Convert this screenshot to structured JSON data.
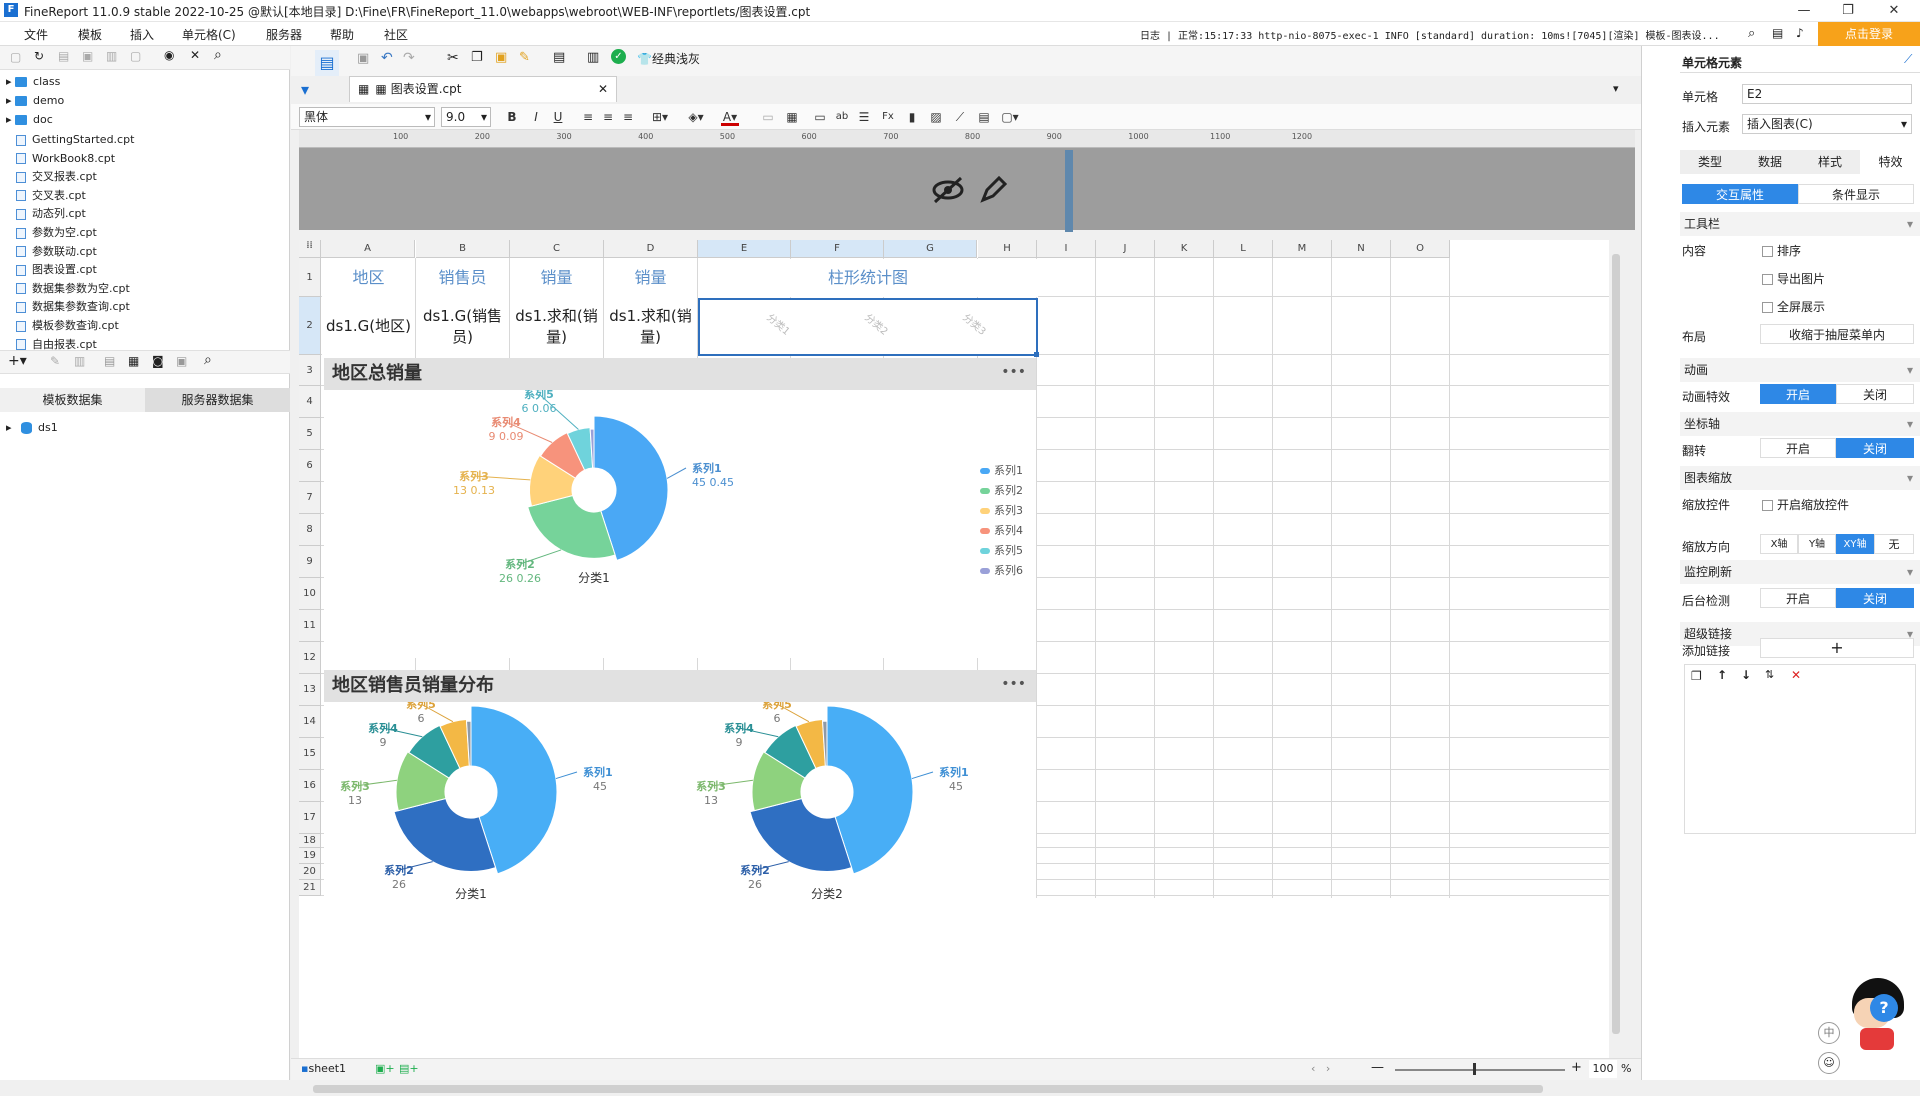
{
  "window": {
    "title": "FineReport 11.0.9 stable 2022-10-25 @默认[本地目录]   D:\\Fine\\FR\\FineReport_11.0\\webapps\\webroot\\WEB-INF\\reportlets/图表设置.cpt",
    "minimize": "—",
    "restore": "❐",
    "close": "✕"
  },
  "menu": {
    "items": [
      "文件",
      "模板",
      "插入",
      "单元格(C)",
      "服务器",
      "帮助",
      "社区"
    ],
    "log": "日志  | 正常:15:17:33 http-nio-8075-exec-1 INFO [standard] duration: 10ms![7045][渲染] 模板-图表设...",
    "login": "点击登录"
  },
  "left": {
    "tree": [
      "class",
      "demo",
      "doc"
    ],
    "files": [
      "GettingStarted.cpt",
      "WorkBook8.cpt",
      "交叉报表.cpt",
      "交叉表.cpt",
      "动态列.cpt",
      "参数为空.cpt",
      "参数联动.cpt",
      "图表设置.cpt",
      "数据集参数为空.cpt",
      "数据集参数查询.cpt",
      "模板参数查询.cpt",
      "自由报表.cpt"
    ],
    "tab_template": "模板数据集",
    "tab_server": "服务器数据集",
    "dataset": "ds1"
  },
  "editor": {
    "doc_tab": "图表设置.cpt",
    "font": "黑体",
    "font_size": "9.0",
    "classic_btn": "经典浅灰",
    "ruler_ticks": [
      "100",
      "200",
      "300",
      "400",
      "500",
      "600",
      "700",
      "800",
      "900",
      "1000",
      "1100",
      "1200"
    ],
    "columns": [
      "A",
      "B",
      "C",
      "D",
      "E",
      "F",
      "G",
      "H",
      "I",
      "J",
      "K",
      "L",
      "M",
      "N",
      "O"
    ],
    "rows": [
      "1",
      "2",
      "3",
      "4",
      "5",
      "6",
      "7",
      "8",
      "9",
      "10",
      "11",
      "12",
      "13",
      "14",
      "15",
      "16",
      "17",
      "18",
      "19",
      "20",
      "21"
    ],
    "headers": [
      "地区",
      "销售员",
      "销量",
      "销量",
      "柱形统计图"
    ],
    "data_row": [
      "ds1.G(地区)",
      "ds1.G(销售员)",
      "ds1.求和(销量)",
      "ds1.求和(销量)"
    ],
    "mini_cats": [
      "分类1",
      "分类2",
      "分类3"
    ],
    "sheet": "sheet1",
    "zoom": "100"
  },
  "chart1": {
    "title": "地区总销量",
    "legend": [
      "系列1",
      "系列2",
      "系列3",
      "系列4",
      "系列5",
      "系列6"
    ],
    "category": "分类1",
    "labels": [
      {
        "name": "系列1",
        "val": "45  0.45"
      },
      {
        "name": "系列2",
        "val": "26  0.26"
      },
      {
        "name": "系列3",
        "val": "13  0.13"
      },
      {
        "name": "系列4",
        "val": "9  0.09"
      },
      {
        "name": "系列5",
        "val": "6  0.06"
      }
    ]
  },
  "chart2": {
    "title": "地区销售员销量分布",
    "cat_left": "分类1",
    "cat_right": "分类2",
    "labels": [
      {
        "name": "系列1",
        "val": "45"
      },
      {
        "name": "系列2",
        "val": "26"
      },
      {
        "name": "系列3",
        "val": "13"
      },
      {
        "name": "系列4",
        "val": "9"
      },
      {
        "name": "系列5",
        "val": "6"
      }
    ]
  },
  "chart_data": [
    {
      "type": "pie",
      "title": "地区总销量",
      "categories": [
        "分类1"
      ],
      "series": [
        {
          "name": "系列1",
          "values": [
            45
          ]
        },
        {
          "name": "系列2",
          "values": [
            26
          ]
        },
        {
          "name": "系列3",
          "values": [
            13
          ]
        },
        {
          "name": "系列4",
          "values": [
            9
          ]
        },
        {
          "name": "系列5",
          "values": [
            6
          ]
        },
        {
          "name": "系列6",
          "values": [
            1
          ]
        }
      ]
    },
    {
      "type": "pie",
      "title": "地区销售员销量分布",
      "categories": [
        "分类1",
        "分类2"
      ],
      "series": [
        {
          "name": "系列1",
          "values": [
            45,
            45
          ]
        },
        {
          "name": "系列2",
          "values": [
            26,
            26
          ]
        },
        {
          "name": "系列3",
          "values": [
            13,
            13
          ]
        },
        {
          "name": "系列4",
          "values": [
            9,
            9
          ]
        },
        {
          "name": "系列5",
          "values": [
            6,
            6
          ]
        },
        {
          "name": "系列6",
          "values": [
            1,
            1
          ]
        }
      ]
    }
  ],
  "colors": {
    "pie1": [
      "#4aa8f5",
      "#76d39a",
      "#ffd27a",
      "#f7937c",
      "#6fd3dc",
      "#9aa0d8"
    ],
    "pie2": [
      "#48aef6",
      "#2f6fc2",
      "#8ed27e",
      "#2e9fa0",
      "#f3b845",
      "#8f9aa6"
    ],
    "label1": [
      "#4b8fd0",
      "#63b77e",
      "#e5b24d",
      "#e88a72",
      "#4fb0c0"
    ],
    "label2": [
      "#3e8fd4",
      "#2c5fa8",
      "#7cb86c",
      "#2a8f95",
      "#dca23a"
    ]
  },
  "right": {
    "title": "单元格元素",
    "cell_label": "单元格",
    "cell_value": "E2",
    "insert_label": "插入元素",
    "insert_value": "插入图表(C)",
    "tabs": [
      "类型",
      "数据",
      "样式",
      "特效"
    ],
    "subtabs": [
      "交互属性",
      "条件显示"
    ],
    "toolbar": "工具栏",
    "content": "内容",
    "opts": [
      "排序",
      "导出图片",
      "全屏展示"
    ],
    "layout": "布局",
    "layout_val": "收缩于抽屉菜单内",
    "anim": "动画",
    "anim_effect": "动画特效",
    "on": "开启",
    "off": "关闭",
    "axis": "坐标轴",
    "flip": "翻转",
    "zoom": "图表缩放",
    "zoom_ctrl": "缩放控件",
    "zoom_enable": "开启缩放控件",
    "zoom_dir": "缩放方向",
    "dirs": [
      "X轴",
      "Y轴",
      "XY轴",
      "无"
    ],
    "monitor": "监控刷新",
    "backend": "后台检测",
    "hyperlink": "超级链接",
    "add_link": "添加链接",
    "plus": "+"
  }
}
